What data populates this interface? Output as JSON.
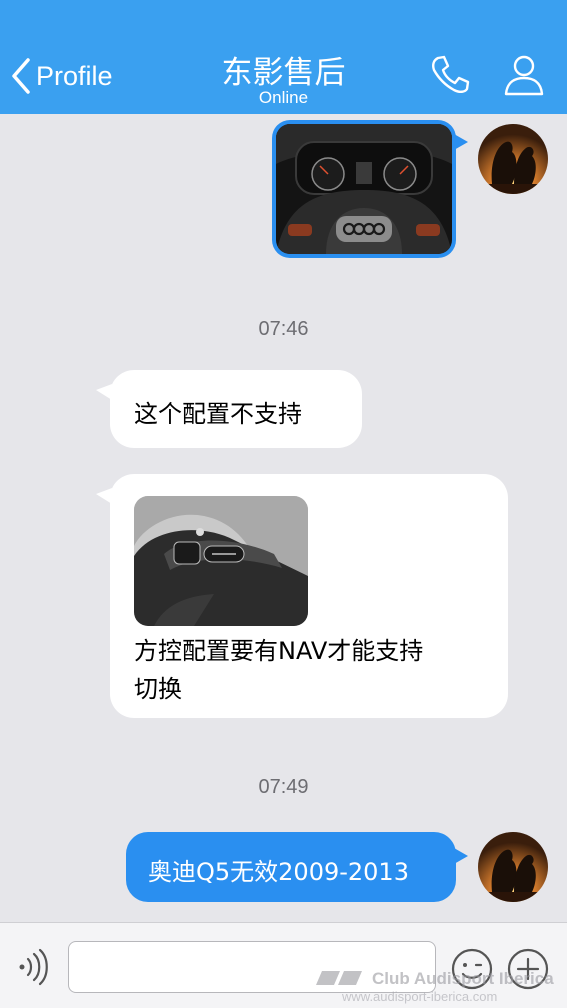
{
  "header": {
    "back_label": "Profile",
    "title": "东影售后",
    "status": "Online",
    "bg_color": "#3aa0f0"
  },
  "messages": [
    {
      "direction": "outgoing",
      "type": "image",
      "image": "car-dashboard-steering-wheel-photo"
    },
    {
      "type": "timestamp",
      "text": "07:46"
    },
    {
      "direction": "incoming",
      "type": "text",
      "text": "这个配置不支持"
    },
    {
      "direction": "incoming",
      "type": "image-text",
      "image": "steering-wheel-buttons-photo",
      "line1": "方控配置要有NAV才能支持",
      "line2": "切换"
    },
    {
      "type": "timestamp",
      "text": "07:49"
    },
    {
      "direction": "outgoing",
      "type": "text",
      "text": "奥迪Q5无效2009-2013"
    }
  ],
  "input_bar": {
    "placeholder": "",
    "icons": [
      "voice-icon",
      "emoji-icon",
      "plus-icon"
    ]
  },
  "watermark": {
    "line1": "Club Audisport Iberica",
    "line2": "www.audisport-iberica.com"
  },
  "colors": {
    "accent": "#2a8ff0",
    "chat_bg": "#e6e6ea",
    "incoming_bubble": "#ffffff"
  }
}
